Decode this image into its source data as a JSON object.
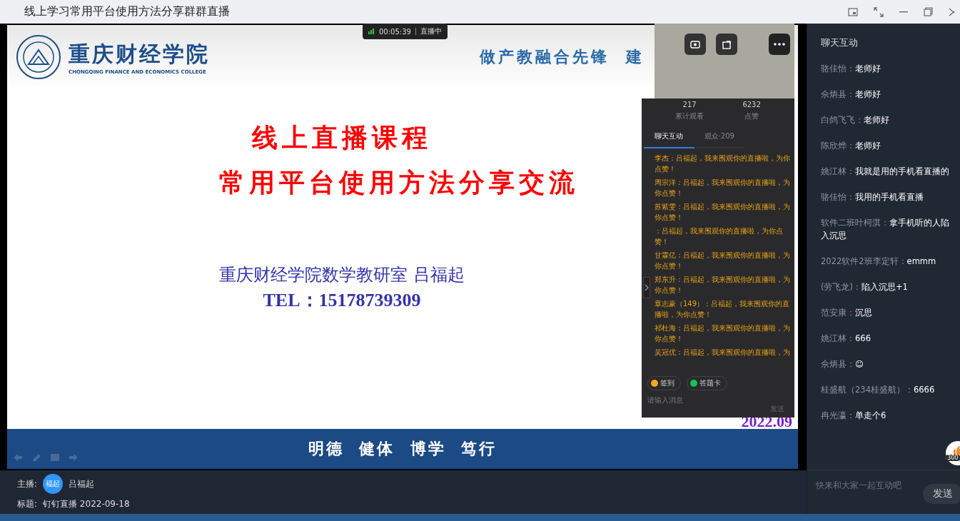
{
  "window": {
    "title": "线上学习常用平台使用方法分享群群直播"
  },
  "live_status": {
    "time": "00:05:39",
    "label": "直播中"
  },
  "slide": {
    "college_name": "重庆财经学院",
    "college_name_en": "CHONGQING FINANCE AND ECONOMICS COLLEGE",
    "slogan": "做产教融合先锋  建",
    "title_1": "线上直播课程",
    "title_2": "常用平台使用方法分享交流",
    "author": "重庆财经学院数学教研室 吕福起",
    "phone": "TEL：15178739309",
    "date": "2022.09",
    "motto": "明德  健体  博学  笃行"
  },
  "overlay": {
    "stats": [
      {
        "value": "217",
        "label": "累计观看"
      },
      {
        "value": "6232",
        "label": "点赞"
      }
    ],
    "tabs": [
      {
        "label": "聊天互动",
        "selected": true
      },
      {
        "label": "观众·209",
        "selected": false
      }
    ],
    "messages": [
      "李杰：吕福起，我来围观你的直播啦，为你点赞！",
      "周宗洋：吕福起，我来围观你的直播啦，为你点赞！",
      "苏紫雯：吕福起，我来围观你的直播啦，为你点赞！",
      "：吕福起，我来围观你的直播啦，为你点赞！",
      "甘霖亿：吕福起，我来围观你的直播啦，为你点赞！",
      "郑东升：吕福起，我来围观你的直播啦，为你点赞！",
      "章志豪（149）：吕福起，我来围观你的直播啦，为你点赞！",
      "祁杜海：吕福起，我来围观你的直播啦，为你点赞！",
      "吴冠优：吕福起，我来围观你的直播啦，为"
    ],
    "actions": [
      {
        "label": "签到",
        "color": "#f5a623"
      },
      {
        "label": "答题卡",
        "color": "#19c25a"
      }
    ],
    "input": {
      "placeholder": "请输入消息"
    },
    "send": "发送"
  },
  "host": {
    "label": "主播:",
    "avatar": "福起",
    "name": "吕福起"
  },
  "stream_title": {
    "label": "标题:",
    "value": "钉钉直播 2022-09-18"
  },
  "chat": {
    "title": "聊天互动",
    "messages": [
      {
        "name": "骆佳怡：",
        "text": "老师好"
      },
      {
        "name": "佘炳县：",
        "text": "老师好"
      },
      {
        "name": "白鸽飞飞：",
        "text": "老师好"
      },
      {
        "name": "陈欣烨：",
        "text": "老师好"
      },
      {
        "name": "姚江林：",
        "text": "我就是用的手机看直播的"
      },
      {
        "name": "骆佳怡：",
        "text": "我用的手机看直播"
      },
      {
        "name": "软件二班叶柯淇：",
        "text": "拿手机听的人陷入沉思"
      },
      {
        "name": "2022软件2班李定轩：",
        "text": "emmm"
      },
      {
        "name": "(劳飞龙)：",
        "text": "陷入沉思+1"
      },
      {
        "name": "范安康：",
        "text": "沉思"
      },
      {
        "name": "姚江林：",
        "text": "666"
      },
      {
        "name": "佘炳县：",
        "text": "☺"
      },
      {
        "name": "桂盛航（234桂盛航）：",
        "text": "6666"
      },
      {
        "name": "冉光瀛：",
        "text": "单走个6"
      }
    ],
    "likes": "300",
    "input": {
      "placeholder": "快来和大家一起互动吧"
    },
    "send": "发送"
  }
}
